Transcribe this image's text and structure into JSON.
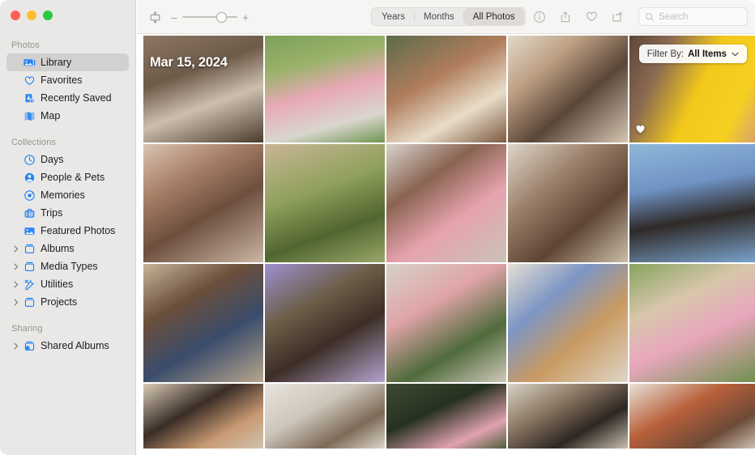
{
  "window": {
    "traffic_lights": [
      {
        "name": "close",
        "color": "#ff5f57"
      },
      {
        "name": "minimize",
        "color": "#febc2e"
      },
      {
        "name": "maximize",
        "color": "#28c840"
      }
    ],
    "accent_color": "#1c7ef3"
  },
  "sidebar": {
    "sections": [
      {
        "title": "Photos",
        "items": [
          {
            "label": "Library",
            "icon": "library-icon",
            "selected": true,
            "disclosure": false
          },
          {
            "label": "Favorites",
            "icon": "heart-icon",
            "selected": false,
            "disclosure": false
          },
          {
            "label": "Recently Saved",
            "icon": "recently-saved-icon",
            "selected": false,
            "disclosure": false
          },
          {
            "label": "Map",
            "icon": "map-icon",
            "selected": false,
            "disclosure": false
          }
        ]
      },
      {
        "title": "Collections",
        "items": [
          {
            "label": "Days",
            "icon": "clock-icon",
            "selected": false,
            "disclosure": false
          },
          {
            "label": "People & Pets",
            "icon": "person-icon",
            "selected": false,
            "disclosure": false
          },
          {
            "label": "Memories",
            "icon": "memories-icon",
            "selected": false,
            "disclosure": false
          },
          {
            "label": "Trips",
            "icon": "suitcase-icon",
            "selected": false,
            "disclosure": false
          },
          {
            "label": "Featured Photos",
            "icon": "featured-photo-icon",
            "selected": false,
            "disclosure": false
          },
          {
            "label": "Albums",
            "icon": "album-icon",
            "selected": false,
            "disclosure": true
          },
          {
            "label": "Media Types",
            "icon": "album-icon",
            "selected": false,
            "disclosure": true
          },
          {
            "label": "Utilities",
            "icon": "utilities-icon",
            "selected": false,
            "disclosure": true
          },
          {
            "label": "Projects",
            "icon": "album-icon",
            "selected": false,
            "disclosure": true
          }
        ]
      },
      {
        "title": "Sharing",
        "items": [
          {
            "label": "Shared Albums",
            "icon": "shared-album-icon",
            "selected": false,
            "disclosure": true
          }
        ]
      }
    ]
  },
  "toolbar": {
    "aspect_button": "aspect-ratio-icon",
    "zoom": {
      "minus": "–",
      "plus": "+",
      "value": 62
    },
    "segments": [
      {
        "label": "Years",
        "active": false
      },
      {
        "label": "Months",
        "active": false
      },
      {
        "label": "All Photos",
        "active": true
      }
    ],
    "icon_buttons": [
      {
        "name": "info-icon",
        "title": "Info"
      },
      {
        "name": "share-icon",
        "title": "Share"
      },
      {
        "name": "favorite-heart-icon",
        "title": "Favorite"
      },
      {
        "name": "rotate-icon",
        "title": "Rotate"
      }
    ],
    "search": {
      "placeholder": "Search",
      "value": "",
      "icon": "search-icon"
    }
  },
  "grid": {
    "date_label": "Mar 15, 2024",
    "filter": {
      "label": "Filter By:",
      "value": "All Items",
      "chevron": "⌄"
    },
    "columns": 5,
    "rows": [
      {
        "height": 132,
        "cells": [
          {
            "name": "photo-thumbnail",
            "alt": "child building blocks indoors",
            "favorite": false,
            "bg": "linear-gradient(160deg,#8d7663 0%,#6d5a49 35%,#cdbfae 62%,#4a3b2e 100%)"
          },
          {
            "name": "photo-thumbnail",
            "alt": "child cartwheel on lawn",
            "favorite": false,
            "bg": "linear-gradient(165deg,#7ba05a 0%,#9ab26a 28%,#e8a9b6 52%,#d9d6cd 78%,#6f9552 100%)"
          },
          {
            "name": "photo-thumbnail",
            "alt": "two kids smiling outdoors",
            "favorite": false,
            "bg": "linear-gradient(150deg,#5c6b4a 0%,#b07d5c 40%,#e8ddc9 70%,#7d5a42 100%)"
          },
          {
            "name": "photo-thumbnail",
            "alt": "kids on couch at home",
            "favorite": false,
            "bg": "linear-gradient(140deg,#e2d9ca 0%,#bc9e82 30%,#5a4638 60%,#d5c6b3 100%)"
          },
          {
            "name": "photo-thumbnail",
            "alt": "kids with yellow balloon",
            "favorite": true,
            "bg": "linear-gradient(115deg,#5d4638 0%,#8b6a52 24%,#f2c81b 52%,#f5d021 78%,#d39b7c 100%)"
          }
        ]
      },
      {
        "height": 146,
        "cells": [
          {
            "name": "photo-thumbnail",
            "alt": "three kids making faces",
            "favorite": false,
            "bg": "linear-gradient(150deg,#d9c4b2 0%,#a87f68 30%,#6d4f3e 58%,#cbb6a4 100%)"
          },
          {
            "name": "photo-thumbnail",
            "alt": "child in garden greenery",
            "favorite": false,
            "bg": "linear-gradient(160deg,#c9b695 0%,#8fa05c 40%,#51662f 70%,#9aa86a 100%)"
          },
          {
            "name": "photo-thumbnail",
            "alt": "child in pink hoodie by window",
            "favorite": false,
            "bg": "linear-gradient(145deg,#d8d4cd 0%,#8a6352 32%,#e6a3ad 62%,#c9c3b8 100%)"
          },
          {
            "name": "photo-thumbnail",
            "alt": "two siblings on sofa",
            "favorite": false,
            "bg": "linear-gradient(140deg,#ded6c8 0%,#9a7f6a 35%,#5e4434 65%,#cbbfa9 100%)"
          },
          {
            "name": "photo-thumbnail",
            "alt": "person in blue knit sweater",
            "favorite": false,
            "bg": "linear-gradient(170deg,#8fb8d9 0%,#6f93c4 35%,#2f2a28 62%,#7ba5cf 100%)"
          }
        ]
      },
      {
        "height": 146,
        "cells": [
          {
            "name": "photo-thumbnail",
            "alt": "family playing blocks on bed",
            "favorite": false,
            "bg": "linear-gradient(150deg,#c6b49a 0%,#6b4f3b 32%,#3a4c6b 62%,#b8a58c 100%)"
          },
          {
            "name": "photo-thumbnail",
            "alt": "two people in purple sweaters",
            "favorite": false,
            "bg": "linear-gradient(150deg,#9f8fd0 0%,#6b5e48 35%,#3c2e26 62%,#b6a3cf 100%)"
          },
          {
            "name": "photo-thumbnail",
            "alt": "two kids hugging outdoors",
            "favorite": false,
            "bg": "linear-gradient(150deg,#d6d2c6 0%,#e0a4a8 35%,#4f6b3c 68%,#cfc9bb 100%)"
          },
          {
            "name": "photo-thumbnail",
            "alt": "kids lying on bed in bedroom",
            "favorite": false,
            "bg": "linear-gradient(140deg,#e6dfd3 0%,#7d96c4 32%,#c99a62 62%,#ded5c6 100%)"
          },
          {
            "name": "photo-thumbnail",
            "alt": "child with pink ball in yard",
            "favorite": false,
            "bg": "linear-gradient(155deg,#86a45e 0%,#d8c6ab 32%,#e8a7bd 58%,#6b8f48 100%)"
          }
        ]
      },
      {
        "height": 80,
        "cells": [
          {
            "name": "photo-thumbnail",
            "alt": "adult bending over child indoors",
            "favorite": false,
            "bg": "linear-gradient(150deg,#d9cdb8 0%,#3a2d26 40%,#c89a72 72%,#cfc2ae 100%)"
          },
          {
            "name": "photo-thumbnail",
            "alt": "child in striped shirt indoors",
            "favorite": false,
            "bg": "linear-gradient(150deg,#e8e4dc 0%,#cdc6ba 40%,#7d6a58 72%,#ddd7cb 100%)"
          },
          {
            "name": "photo-thumbnail",
            "alt": "person in pink outdoors at dusk",
            "favorite": false,
            "bg": "linear-gradient(155deg,#3f4a33 0%,#26301f 40%,#e0a2b0 76%,#50603c 100%)"
          },
          {
            "name": "photo-thumbnail",
            "alt": "two people laughing together",
            "favorite": false,
            "bg": "linear-gradient(150deg,#d8d2c6 0%,#8e7a66 35%,#2e2622 68%,#c9bfae 100%)"
          },
          {
            "name": "photo-thumbnail",
            "alt": "person in orange top indoors",
            "favorite": false,
            "bg": "linear-gradient(150deg,#e8e2d8 0%,#b8603a 40%,#6d4a38 72%,#d6cec0 100%)"
          }
        ]
      }
    ]
  }
}
